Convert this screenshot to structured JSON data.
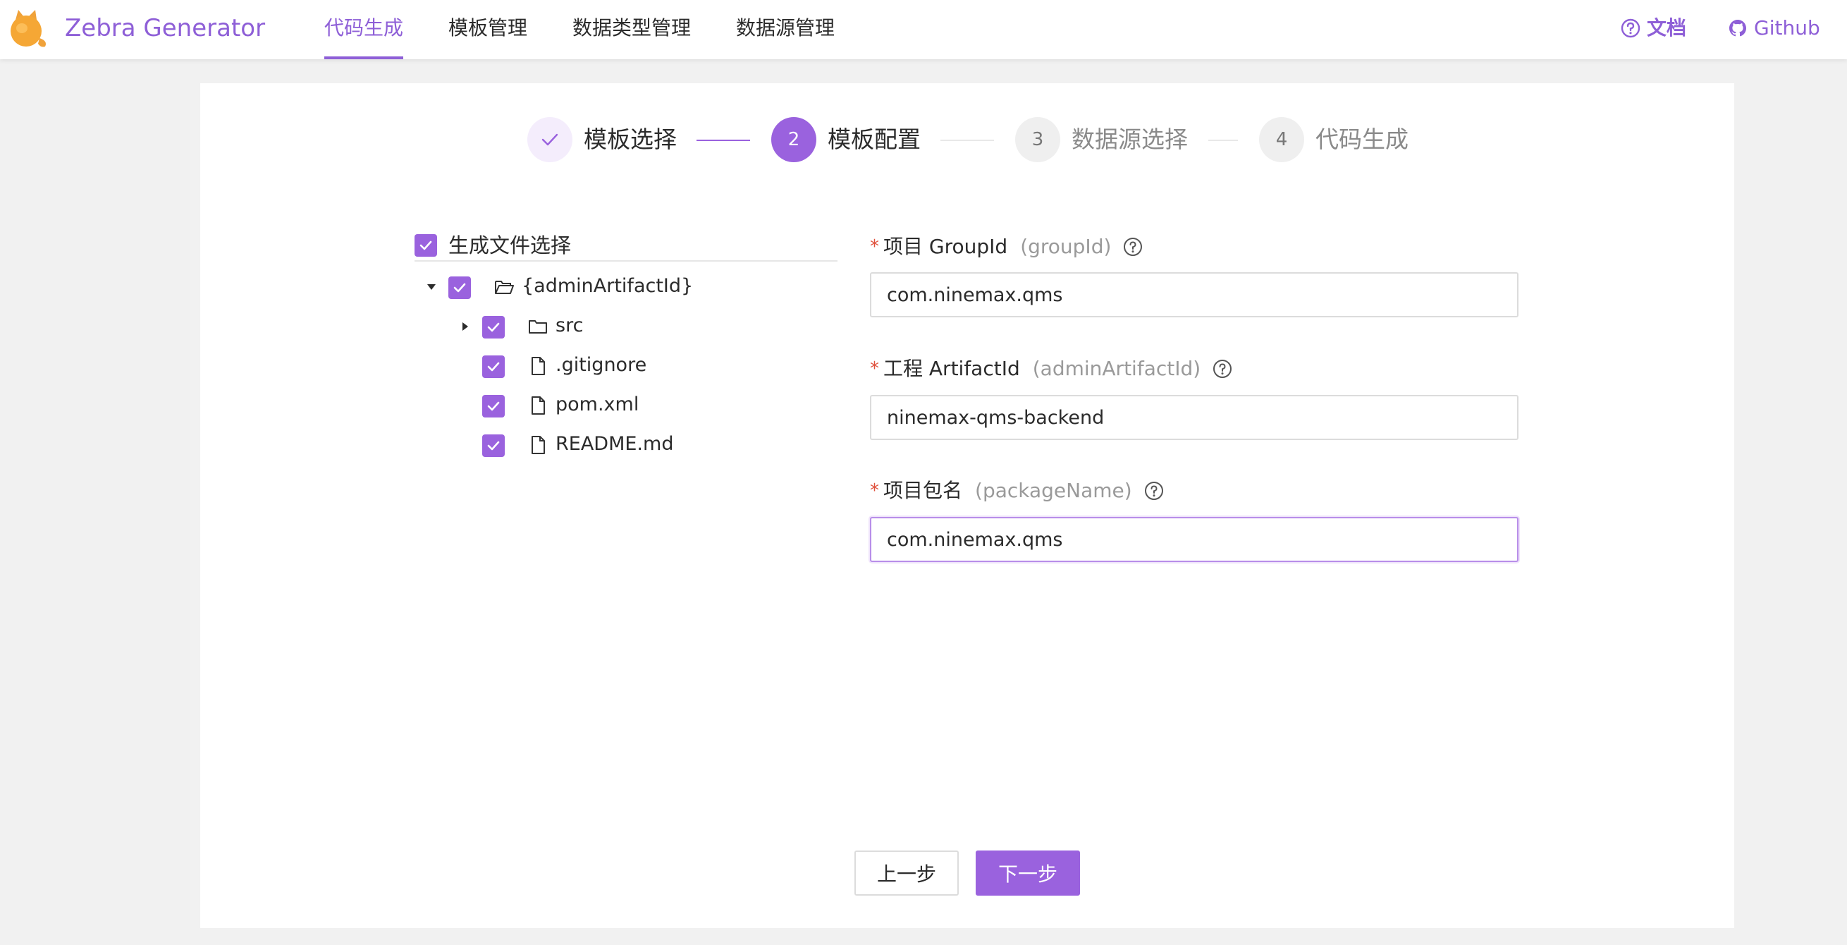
{
  "app": {
    "title": "Zebra Generator"
  },
  "nav": {
    "tabs": [
      {
        "label": "代码生成",
        "active": true
      },
      {
        "label": "模板管理"
      },
      {
        "label": "数据类型管理"
      },
      {
        "label": "数据源管理"
      }
    ]
  },
  "top_links": {
    "docs": "文档",
    "github": "Github"
  },
  "steps": [
    {
      "number": "1",
      "title": "模板选择",
      "status": "done"
    },
    {
      "number": "2",
      "title": "模板配置",
      "status": "current"
    },
    {
      "number": "3",
      "title": "数据源选择",
      "status": "pending"
    },
    {
      "number": "4",
      "title": "代码生成",
      "status": "pending"
    }
  ],
  "file_tree": {
    "header_label": "生成文件选择",
    "header_checked": true,
    "nodes": [
      {
        "label": "{adminArtifactId}",
        "type": "folder-open",
        "expanded": true,
        "checked": true
      },
      {
        "label": "src",
        "type": "folder",
        "expanded": false,
        "checked": true
      },
      {
        "label": ".gitignore",
        "type": "file",
        "checked": true
      },
      {
        "label": "pom.xml",
        "type": "file",
        "checked": true
      },
      {
        "label": "README.md",
        "type": "file",
        "checked": true
      }
    ]
  },
  "form": {
    "fields": [
      {
        "label": "项目 GroupId",
        "var": "(groupId)",
        "value": "com.ninemax.qms",
        "required": true
      },
      {
        "label": "工程 ArtifactId",
        "var": "(adminArtifactId)",
        "value": "ninemax-qms-backend",
        "required": true
      },
      {
        "label": "项目包名",
        "var": "(packageName)",
        "value": "com.ninemax.qms",
        "required": true,
        "focused": true
      }
    ]
  },
  "buttons": {
    "prev": "上一步",
    "next": "下一步"
  },
  "colors": {
    "accent": "#9a62de",
    "required": "#e0523e"
  }
}
